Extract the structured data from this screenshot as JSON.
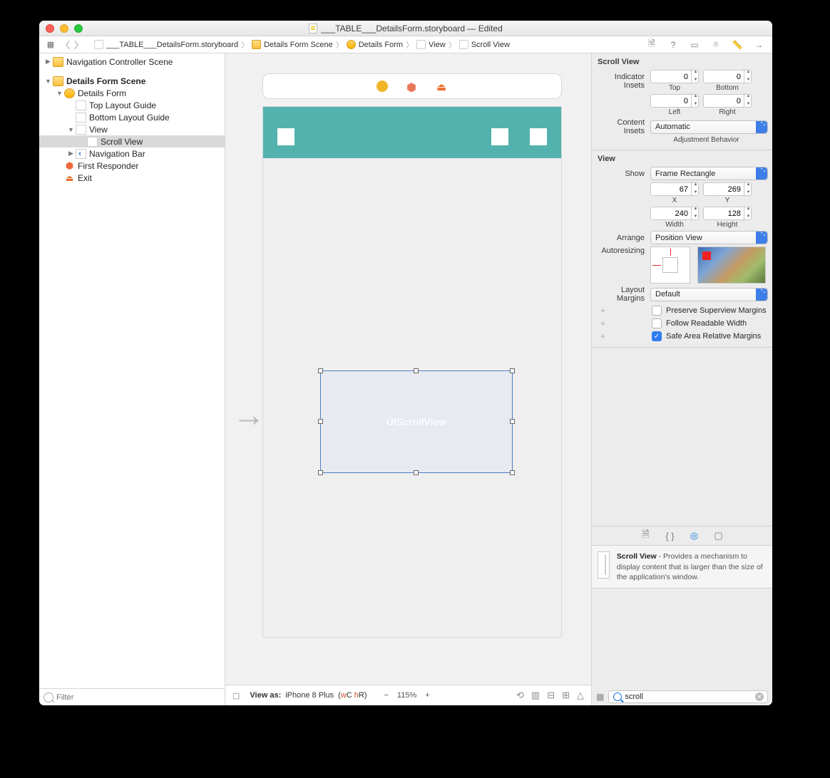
{
  "window": {
    "title": "___TABLE___DetailsForm.storyboard — Edited"
  },
  "jumpbar": {
    "crumbs": [
      {
        "icon": "file",
        "label": "___TABLE___DetailsForm.storyboard"
      },
      {
        "icon": "folder",
        "label": "Details Form Scene"
      },
      {
        "icon": "vc",
        "label": "Details Form"
      },
      {
        "icon": "view",
        "label": "View"
      },
      {
        "icon": "view",
        "label": "Scroll View"
      }
    ]
  },
  "navigator": {
    "rows": [
      {
        "depth": 1,
        "disc": "▶",
        "icon": "folder",
        "label": "Navigation Controller Scene"
      },
      {
        "depth": 1,
        "disc": "▼",
        "icon": "folder",
        "label": "Details Form Scene",
        "bold": true
      },
      {
        "depth": 2,
        "disc": "▼",
        "icon": "vc",
        "label": "Details Form"
      },
      {
        "depth": 3,
        "disc": "",
        "icon": "view",
        "label": "Top Layout Guide"
      },
      {
        "depth": 3,
        "disc": "",
        "icon": "view",
        "label": "Bottom Layout Guide"
      },
      {
        "depth": 3,
        "disc": "▼",
        "icon": "view",
        "label": "View"
      },
      {
        "depth": 4,
        "disc": "",
        "icon": "view",
        "label": "Scroll View",
        "selected": true
      },
      {
        "depth": 3,
        "disc": "▶",
        "icon": "nav",
        "label": "Navigation Bar"
      },
      {
        "depth": 2,
        "disc": "",
        "icon": "cube",
        "label": "First Responder"
      },
      {
        "depth": 2,
        "disc": "",
        "icon": "exit",
        "label": "Exit"
      }
    ],
    "filter_placeholder": "Filter"
  },
  "canvas": {
    "scrollview_label": "UIScrollView",
    "footer": {
      "view_as_prefix": "View as: ",
      "device": "iPhone 8 Plus",
      "wchr": "(wC hR)",
      "zoom": "115%"
    }
  },
  "inspector": {
    "section1": {
      "title": "Scroll View",
      "indicator_insets_label": "Indicator Insets",
      "top": "0",
      "bottom": "0",
      "left": "0",
      "right": "0",
      "top_l": "Top",
      "bottom_l": "Bottom",
      "left_l": "Left",
      "right_l": "Right",
      "content_insets_label": "Content Insets",
      "content_insets_value": "Automatic",
      "adjustment_behavior": "Adjustment Behavior"
    },
    "section2": {
      "title": "View",
      "show_label": "Show",
      "show_value": "Frame Rectangle",
      "x": "67",
      "y": "269",
      "x_l": "X",
      "y_l": "Y",
      "width": "240",
      "height": "128",
      "w_l": "Width",
      "h_l": "Height",
      "arrange_label": "Arrange",
      "arrange_value": "Position View",
      "autoresizing_label": "Autoresizing",
      "layout_margins_label": "Layout Margins",
      "layout_margins_value": "Default",
      "chk1": "Preserve Superview Margins",
      "chk2": "Follow Readable Width",
      "chk3": "Safe Area Relative Margins"
    },
    "library": {
      "item_title": "Scroll View",
      "item_desc": " - Provides a mechanism to display content that is larger than the size of the application's window.",
      "search_value": "scroll"
    }
  }
}
